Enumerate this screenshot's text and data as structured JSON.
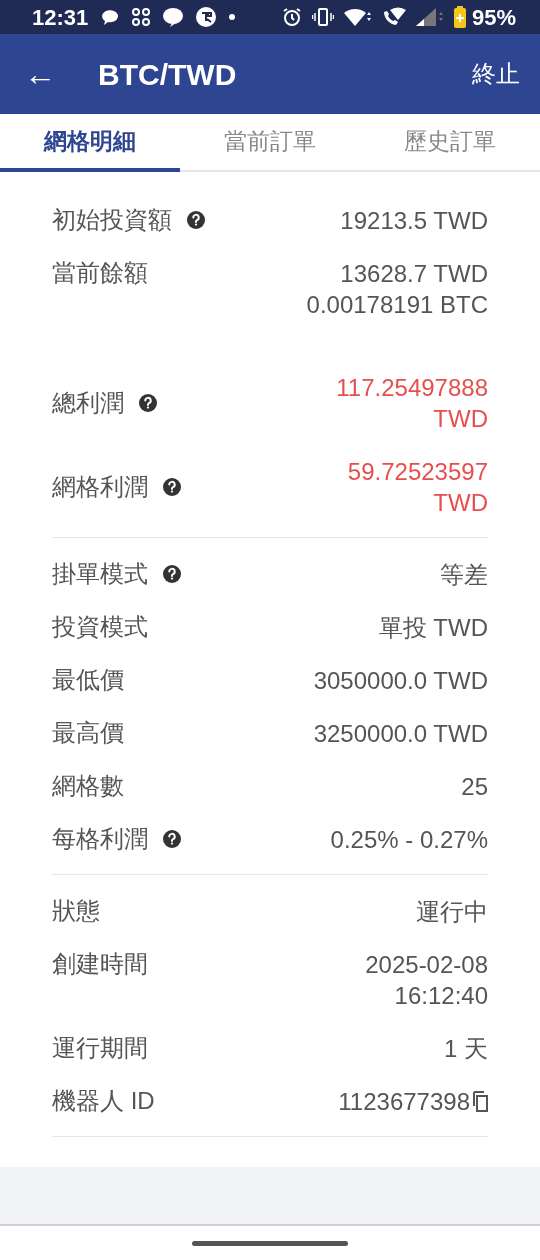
{
  "status_bar": {
    "time": "12:31",
    "battery": "95%"
  },
  "header": {
    "back": "←",
    "title": "BTC/TWD",
    "action": "終止"
  },
  "tabs": [
    {
      "label": "網格明細",
      "selected": true
    },
    {
      "label": "當前訂單",
      "selected": false
    },
    {
      "label": "歷史訂單",
      "selected": false
    }
  ],
  "sections": [
    {
      "rows": [
        {
          "label": "初始投資額",
          "help": true,
          "values": [
            "19213.5 TWD"
          ]
        },
        {
          "label": "當前餘額",
          "help": false,
          "values": [
            "13628.7 TWD",
            "0.00178191 BTC"
          ]
        },
        {
          "label": "總利潤",
          "help": true,
          "highlight": true,
          "values": [
            "117.25497888",
            "TWD"
          ]
        },
        {
          "label": "網格利潤",
          "help": true,
          "highlight": true,
          "values": [
            "59.72523597",
            "TWD"
          ]
        }
      ]
    },
    {
      "rows": [
        {
          "label": "掛單模式",
          "help": true,
          "values": [
            "等差"
          ]
        },
        {
          "label": "投資模式",
          "help": false,
          "values": [
            "單投 TWD"
          ]
        },
        {
          "label": "最低價",
          "help": false,
          "values": [
            "3050000.0 TWD"
          ]
        },
        {
          "label": "最高價",
          "help": false,
          "values": [
            "3250000.0 TWD"
          ]
        },
        {
          "label": "網格數",
          "help": false,
          "values": [
            "25"
          ]
        },
        {
          "label": "每格利潤",
          "help": true,
          "values": [
            "0.25% - 0.27%"
          ]
        }
      ]
    },
    {
      "rows": [
        {
          "label": "狀態",
          "help": false,
          "values": [
            "運行中"
          ]
        },
        {
          "label": "創建時間",
          "help": false,
          "values": [
            "2025-02-08",
            "16:12:40"
          ]
        },
        {
          "label": "運行期間",
          "help": false,
          "values": [
            "1 天"
          ]
        },
        {
          "label": "機器人 ID",
          "help": false,
          "copyable": true,
          "values": [
            "1123677398"
          ]
        }
      ]
    }
  ]
}
